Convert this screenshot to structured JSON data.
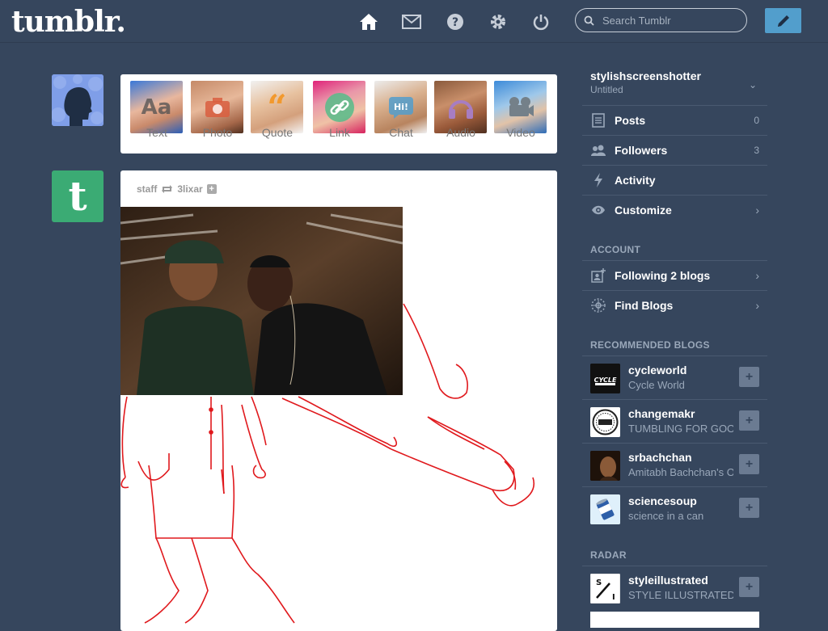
{
  "header": {
    "logo": "tumblr.",
    "search_placeholder": "Search Tumblr",
    "nav": [
      {
        "icon": "home-icon"
      },
      {
        "icon": "mail-icon"
      },
      {
        "icon": "help-icon"
      },
      {
        "icon": "gear-icon"
      },
      {
        "icon": "power-icon"
      }
    ],
    "compose_icon": "pencil-icon"
  },
  "post_types": [
    {
      "label": "Text",
      "icon": "Aa",
      "color": "#4a8fd6"
    },
    {
      "label": "Photo",
      "icon": "camera",
      "color": "#d95e40"
    },
    {
      "label": "Quote",
      "icon": "quote",
      "color": "#f2992e"
    },
    {
      "label": "Link",
      "icon": "link",
      "color": "#56bc8a"
    },
    {
      "label": "Chat",
      "icon": "chat",
      "color": "#529ecc"
    },
    {
      "label": "Audio",
      "icon": "headphones",
      "color": "#a77dc2"
    },
    {
      "label": "Video",
      "icon": "video",
      "color": "#748089"
    }
  ],
  "post": {
    "author": "staff",
    "reblogged_from": "3lixar"
  },
  "sidebar": {
    "blog_name": "stylishscreenshotter",
    "blog_subtitle": "Untitled",
    "items": [
      {
        "label": "Posts",
        "count": "0"
      },
      {
        "label": "Followers",
        "count": "3"
      },
      {
        "label": "Activity",
        "count": ""
      },
      {
        "label": "Customize",
        "count": ""
      }
    ],
    "account_heading": "ACCOUNT",
    "account_items": [
      {
        "label": "Following 2 blogs"
      },
      {
        "label": "Find Blogs"
      }
    ],
    "recommended_heading": "RECOMMENDED BLOGS",
    "recommended": [
      {
        "name": "cycleworld",
        "desc": "Cycle World"
      },
      {
        "name": "changemakr",
        "desc": "TUMBLING FOR GOOD"
      },
      {
        "name": "srbachchan",
        "desc": "Amitabh Bachchan's Official Blog"
      },
      {
        "name": "sciencesoup",
        "desc": "science in a can"
      }
    ],
    "radar_heading": "RADAR",
    "radar": {
      "name": "styleillustrated",
      "desc": "STYLE ILLUSTRATED"
    }
  },
  "colors": {
    "background": "#36465d",
    "accent": "#529ecc",
    "staff_avatar": "#3bab74"
  }
}
